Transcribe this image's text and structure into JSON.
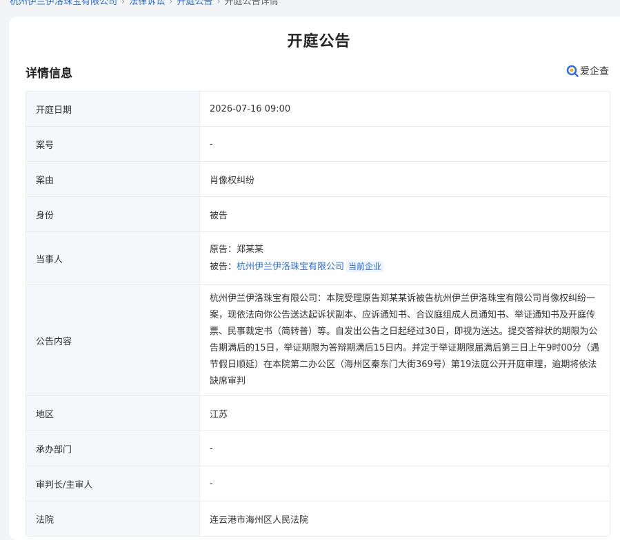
{
  "breadcrumb": {
    "items": [
      "杭州伊兰伊洛珠宝有限公司",
      "法律诉讼",
      "开庭公告",
      "开庭公告详情"
    ]
  },
  "page_title": "开庭公告",
  "section_title": "详情信息",
  "brand": {
    "name": "爱企查",
    "icon": "search-logo-icon",
    "color": "#2f6fd6"
  },
  "details": {
    "date": {
      "label": "开庭日期",
      "value": "2026-07-16 09:00"
    },
    "case_no": {
      "label": "案号",
      "value": "-"
    },
    "cause": {
      "label": "案由",
      "value": "肖像权纠纷"
    },
    "role": {
      "label": "身份",
      "value": "被告"
    },
    "parties": {
      "label": "当事人",
      "plaintiff_prefix": "原告：",
      "plaintiff": "郑某某",
      "defendant_prefix": "被告：",
      "defendant": "杭州伊兰伊洛珠宝有限公司",
      "current_tag": "当前企业"
    },
    "content": {
      "label": "公告内容",
      "value": "杭州伊兰伊洛珠宝有限公司：本院受理原告郑某某诉被告杭州伊兰伊洛珠宝有限公司肖像权纠纷一案，现依法向你公告送达起诉状副本、应诉通知书、合议庭组成人员通知书、举证通知书及开庭传票、民事裁定书（简转普）等。自发出公告之日起经过30日，即视为送达。提交答辩状的期限为公告期满后的15日，举证期限为答辩期满后15日内。并定于举证期限届满后第三日上午9时00分（遇节假日顺延）在本院第二办公区（海州区秦东门大街369号）第19法庭公开开庭审理，逾期将依法缺席审判"
    },
    "region": {
      "label": "地区",
      "value": "江苏"
    },
    "department": {
      "label": "承办部门",
      "value": "-"
    },
    "judge": {
      "label": "审判长/主审人",
      "value": "-"
    },
    "court": {
      "label": "法院",
      "value": "连云港市海州区人民法院"
    }
  }
}
